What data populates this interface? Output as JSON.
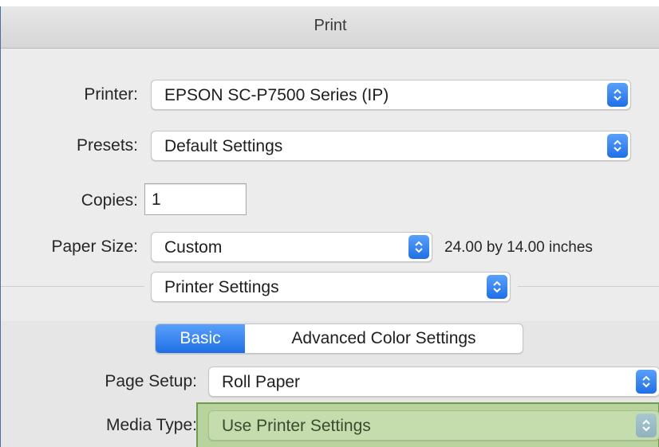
{
  "dialog": {
    "title": "Print"
  },
  "printer": {
    "label": "Printer:",
    "value": "EPSON SC-P7500 Series (IP)"
  },
  "presets": {
    "label": "Presets:",
    "value": "Default Settings"
  },
  "copies": {
    "label": "Copies:",
    "value": "1"
  },
  "paper_size": {
    "label": "Paper Size:",
    "value": "Custom",
    "dimensions": "24.00 by 14.00 inches"
  },
  "panel_select": {
    "value": "Printer Settings"
  },
  "tabs": {
    "basic": "Basic",
    "advanced": "Advanced Color Settings",
    "selected": "Basic"
  },
  "page_setup": {
    "label": "Page Setup:",
    "value": "Roll Paper"
  },
  "media_type": {
    "label": "Media Type:",
    "value": "Use Printer Settings"
  },
  "colors": {
    "accent": "#2f7ef0",
    "highlight": "#b9d39f",
    "highlight_border": "#6f9b4c"
  },
  "icons": {
    "popup_arrows": "up-down-chevron-icon"
  }
}
